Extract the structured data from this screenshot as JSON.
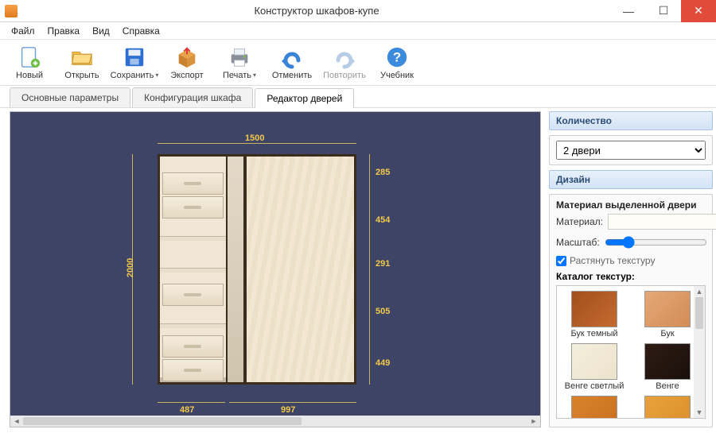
{
  "window": {
    "title": "Конструктор шкафов-купе"
  },
  "menu": {
    "file": "Файл",
    "edit": "Правка",
    "view": "Вид",
    "help": "Справка"
  },
  "toolbar": {
    "new": "Новый",
    "open": "Открыть",
    "save": "Сохранить",
    "export": "Экспорт",
    "print": "Печать",
    "undo": "Отменить",
    "redo": "Повторить",
    "tutorial": "Учебник"
  },
  "tabs": {
    "params": "Основные параметры",
    "config": "Конфигурация шкафа",
    "doors": "Редактор дверей"
  },
  "dimensions": {
    "width_total": "1500",
    "height_total": "2000",
    "bottom_left": "487",
    "bottom_right": "997",
    "right_segments": [
      "285",
      "454",
      "291",
      "505",
      "449"
    ]
  },
  "side": {
    "quantity_head": "Количество",
    "door_count_selected": "2 двери",
    "design_head": "Дизайн",
    "material_section": "Материал выделенной двери",
    "material_label": "Материал:",
    "material_value": "",
    "scale_label": "Масштаб:",
    "stretch_label": "Растянуть текстуру",
    "stretch_checked": true,
    "catalog_title": "Каталог текстур:",
    "textures": [
      {
        "name": "Бук темный",
        "css": "linear-gradient(135deg,#a24f1e,#c46a2e)"
      },
      {
        "name": "Бук",
        "css": "linear-gradient(135deg,#e5a877,#d38c56)"
      },
      {
        "name": "Венге светлый",
        "css": "linear-gradient(135deg,#f4eedd,#ece3cb)"
      },
      {
        "name": "Венге",
        "css": "linear-gradient(135deg,#2e1c14,#1a0f0a)"
      },
      {
        "name": "",
        "css": "linear-gradient(135deg,#d9822b,#c96f1f)"
      },
      {
        "name": "",
        "css": "linear-gradient(135deg,#e8a23c,#d98e2a)"
      }
    ]
  },
  "icons": {
    "new": "file-new-icon",
    "open": "folder-open-icon",
    "save": "floppy-icon",
    "export": "box-export-icon",
    "print": "printer-icon",
    "undo": "undo-icon",
    "redo": "redo-icon",
    "tutorial": "help-icon"
  }
}
